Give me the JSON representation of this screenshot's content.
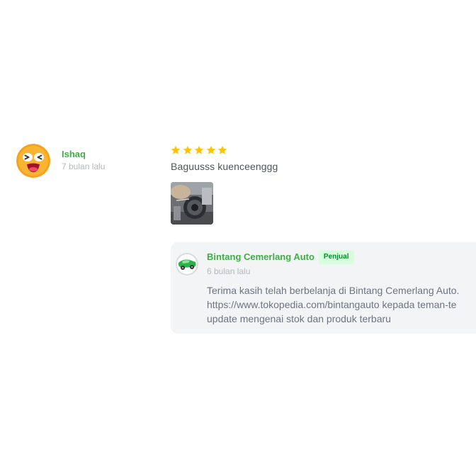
{
  "review": {
    "reviewer": {
      "name": "Ishaq",
      "time": "7 bulan lalu",
      "avatar_icon": "laughing-emoji-avatar"
    },
    "rating": 5,
    "text": "Baguusss kuenceenggg",
    "photo_icon": "product-photo-thumbnail"
  },
  "reply": {
    "seller_name": "Bintang Cemerlang Auto",
    "badge": "Penjual",
    "time": "6 bulan lalu",
    "lines": [
      "Terima kasih telah berbelanja di Bintang Cemerlang Auto.",
      "https://www.tokopedia.com/bintangauto kepada teman-te",
      "update mengenai stok dan produk terbaru"
    ]
  },
  "colors": {
    "brand_green": "#3fad46",
    "star_yellow": "#ffc400",
    "reply_bg": "#f3f4f5",
    "badge_bg": "#d6ffde"
  }
}
